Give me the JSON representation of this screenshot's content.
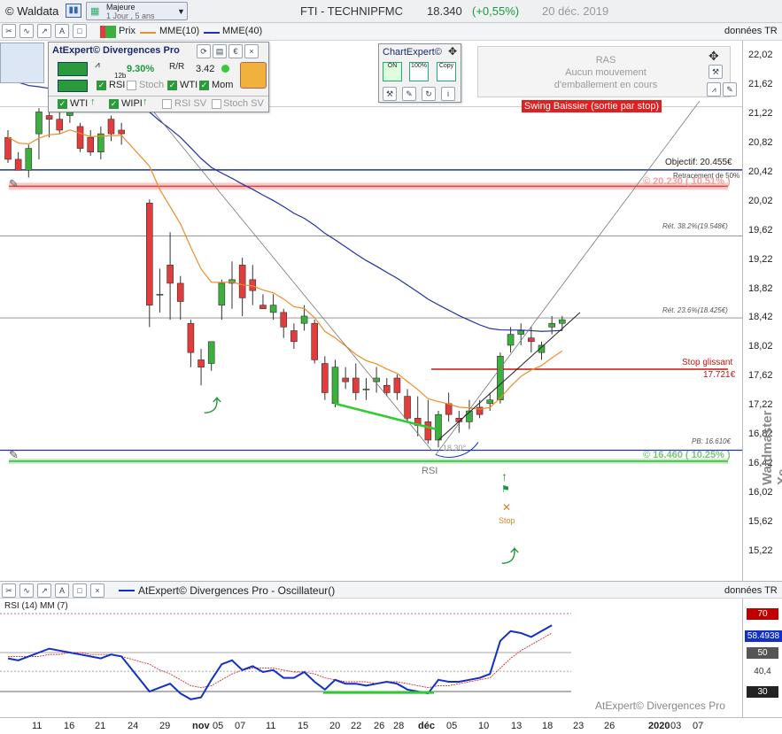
{
  "app": {
    "name": "© Waldata",
    "period_title": "Majeure",
    "period_sub": "1 Jour , 5 ans",
    "symbol": "FTI - TECHNIPFMC",
    "price": "18.340",
    "change": "(+0,55%)",
    "date": "20 déc. 2019"
  },
  "toolbar": {
    "prix": "Prix",
    "mme1": "MME(10)",
    "mme2": "MME(40)",
    "donnees": "données TR"
  },
  "atexpert": {
    "title": "AtExpert© Divergences Pro",
    "val1": "9.30%",
    "val1_sub": "12b",
    "val2": "3.42",
    "rsi": "RSI",
    "stoch": "Stoch",
    "wti": "WTI",
    "mom": "Mom",
    "wti2": "WTI",
    "wipi": "WIPI",
    "rsisv": "RSI SV",
    "stochsv": "Stoch SV"
  },
  "chartexpert": {
    "title": "ChartExpert©",
    "on": "ON",
    "pct": "100%",
    "copy": "Copy"
  },
  "ras": {
    "l1": "RAS",
    "l2": "Aucun mouvement",
    "l3": "d'emballement en cours",
    "swing": "Swing Baissier (sortie par stop)"
  },
  "annotations": {
    "objectif": "Objectif: 20.455€",
    "retr50": "Retracement de 50%",
    "resist": "© 20.230 ( 10.51% )",
    "ret382": "Rét. 38.2%(19.548€)",
    "ret236": "Rét. 23.6%(18.425€)",
    "stop_label": "Stop glissant",
    "stop_val": "17.721€",
    "pb": "PB: 16.610€",
    "support": "© 16.460 ( 10.25% )",
    "angle": "18.30°",
    "rsi_mark": "RSI",
    "stop_icon": "Stop"
  },
  "osc": {
    "title": "AtExpert© Divergences Pro - Oscillateur()",
    "sub": "RSI (14) MM (7)",
    "donnees": "données TR",
    "brand": "AtExpert© Divergences Pro",
    "val": "58.4938",
    "levels": [
      "70",
      "50",
      "40,4",
      "30"
    ]
  },
  "watermark": "Waldmaster Xe",
  "colors": {
    "up": "#3cb03c",
    "down": "#e23c3c",
    "mme10": "#f08c28",
    "mme40": "#22329e",
    "rsi": "#1230c8",
    "green_line": "#2ecc2e"
  },
  "chart_data": {
    "type": "candlestick",
    "yticks": [
      "22,02",
      "21,62",
      "21,22",
      "20,82",
      "20,42",
      "20,02",
      "19,62",
      "19,22",
      "18,82",
      "18,42",
      "18,02",
      "17,62",
      "17,22",
      "16,82",
      "16,42",
      "16,02",
      "15,62",
      "15,22"
    ],
    "xticks": [
      "11",
      "16",
      "21",
      "24",
      "29",
      "nov",
      "05",
      "07",
      "11",
      "15",
      "20",
      "22",
      "26",
      "28",
      "déc",
      "05",
      "10",
      "13",
      "18",
      "23",
      "26",
      "2020",
      "03",
      "07"
    ],
    "ohlc": [
      [
        20.9,
        21.0,
        20.55,
        20.6
      ],
      [
        20.6,
        20.7,
        20.45,
        20.45
      ],
      [
        20.45,
        20.8,
        20.35,
        20.75
      ],
      [
        20.95,
        21.3,
        20.6,
        21.25
      ],
      [
        21.2,
        21.35,
        20.9,
        21.15
      ],
      [
        21.15,
        21.3,
        20.95,
        21.0
      ],
      [
        21.2,
        21.4,
        21.1,
        21.25
      ],
      [
        21.05,
        21.1,
        20.7,
        20.75
      ],
      [
        20.9,
        21.0,
        20.65,
        20.7
      ],
      [
        20.7,
        21.05,
        20.6,
        20.95
      ],
      [
        21.15,
        21.2,
        20.85,
        20.95
      ],
      [
        21.0,
        21.1,
        20.8,
        20.95
      ],
      [
        20.0,
        20.05,
        18.3,
        18.6
      ],
      [
        18.75,
        19.1,
        18.5,
        18.75
      ],
      [
        19.15,
        19.6,
        18.4,
        18.9
      ],
      [
        18.9,
        19.0,
        18.4,
        18.65
      ],
      [
        18.35,
        18.4,
        17.75,
        17.95
      ],
      [
        17.85,
        18.0,
        17.5,
        17.75
      ],
      [
        17.8,
        18.1,
        17.7,
        18.1
      ],
      [
        18.6,
        18.95,
        18.4,
        18.9
      ],
      [
        18.9,
        19.2,
        18.55,
        18.95
      ],
      [
        19.15,
        19.25,
        18.45,
        18.7
      ],
      [
        18.95,
        19.15,
        18.6,
        18.8
      ],
      [
        18.6,
        18.75,
        18.55,
        18.55
      ],
      [
        18.5,
        18.75,
        18.4,
        18.6
      ],
      [
        18.5,
        18.55,
        18.15,
        18.3
      ],
      [
        18.25,
        18.35,
        18.0,
        18.1
      ],
      [
        18.35,
        18.6,
        18.25,
        18.45
      ],
      [
        18.35,
        18.4,
        17.8,
        17.85
      ],
      [
        17.8,
        17.9,
        17.3,
        17.4
      ],
      [
        17.25,
        17.85,
        17.2,
        17.75
      ],
      [
        17.6,
        17.75,
        17.45,
        17.55
      ],
      [
        17.6,
        17.8,
        17.3,
        17.4
      ],
      [
        17.45,
        17.6,
        17.3,
        17.45
      ],
      [
        17.55,
        17.75,
        17.4,
        17.6
      ],
      [
        17.5,
        17.6,
        17.35,
        17.4
      ],
      [
        17.6,
        17.65,
        17.3,
        17.4
      ],
      [
        17.35,
        17.45,
        17.0,
        17.05
      ],
      [
        17.05,
        17.35,
        16.8,
        16.95
      ],
      [
        17.0,
        17.3,
        16.7,
        16.75
      ],
      [
        16.75,
        17.15,
        16.65,
        17.1
      ],
      [
        17.25,
        17.4,
        17.0,
        17.1
      ],
      [
        17.05,
        17.15,
        16.85,
        17.0
      ],
      [
        17.0,
        17.3,
        16.9,
        17.15
      ],
      [
        17.2,
        17.3,
        17.05,
        17.1
      ],
      [
        17.25,
        17.4,
        17.15,
        17.3
      ],
      [
        17.3,
        17.95,
        17.25,
        17.9
      ],
      [
        18.05,
        18.3,
        17.95,
        18.2
      ],
      [
        18.2,
        18.35,
        18.05,
        18.25
      ],
      [
        18.15,
        18.3,
        17.95,
        18.1
      ],
      [
        17.95,
        18.1,
        17.85,
        18.05
      ],
      [
        18.3,
        18.45,
        18.2,
        18.35
      ],
      [
        18.35,
        18.45,
        18.25,
        18.4
      ]
    ],
    "rsi": [
      47,
      46,
      48,
      50,
      52,
      51,
      50,
      49,
      48,
      47,
      49,
      48,
      30,
      32,
      34,
      29,
      26,
      27,
      36,
      44,
      46,
      41,
      43,
      40,
      41,
      37,
      37,
      40,
      35,
      31,
      36,
      34,
      34,
      33,
      34,
      35,
      34,
      31,
      30,
      29,
      36,
      35,
      35,
      36,
      37,
      39,
      56,
      61,
      60,
      58,
      61,
      64
    ],
    "rsi_ma": [
      48,
      48,
      48,
      48,
      49,
      49,
      50,
      50,
      49,
      49,
      49,
      48,
      44,
      41,
      39,
      36,
      33,
      32,
      33,
      36,
      39,
      41,
      42,
      42,
      42,
      41,
      40,
      40,
      39,
      37,
      36,
      35,
      35,
      35,
      34,
      35,
      35,
      34,
      33,
      32,
      33,
      33,
      34,
      35,
      36,
      37,
      42,
      47,
      51,
      54,
      57,
      60
    ]
  }
}
